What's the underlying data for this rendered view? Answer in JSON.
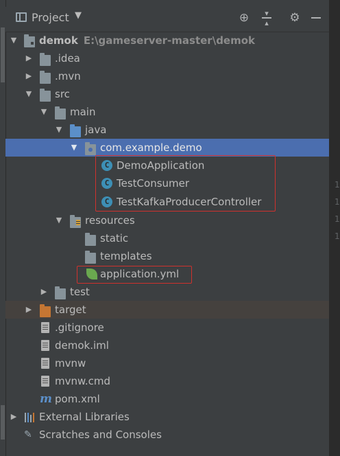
{
  "header": {
    "title": "Project",
    "caret": "▼",
    "actions": [
      "locate-icon",
      "collapse-icon",
      "gear-icon",
      "minimize-icon"
    ]
  },
  "editor": {
    "line_numbers": [
      "1",
      "1",
      "1",
      "1"
    ]
  },
  "tree": {
    "root": {
      "name": "demok",
      "path": "E:\\gameserver-master\\demok"
    },
    "idea": ".idea",
    "mvn": ".mvn",
    "src": "src",
    "main": "main",
    "java": "java",
    "package": "com.example.demo",
    "classes": [
      "DemoApplication",
      "TestConsumer",
      "TestKafkaProducerController"
    ],
    "class_icon_letter": "C",
    "resources": "resources",
    "static": "static",
    "templates": "templates",
    "application_yml": "application.yml",
    "test": "test",
    "target": "target",
    "gitignore": ".gitignore",
    "demok_iml": "demok.iml",
    "mvnw": "mvnw",
    "mvnw_cmd": "mvnw.cmd",
    "pom": "pom.xml",
    "pom_icon_letter": "m",
    "external_libraries": "External Libraries",
    "scratches": "Scratches and Consoles"
  }
}
